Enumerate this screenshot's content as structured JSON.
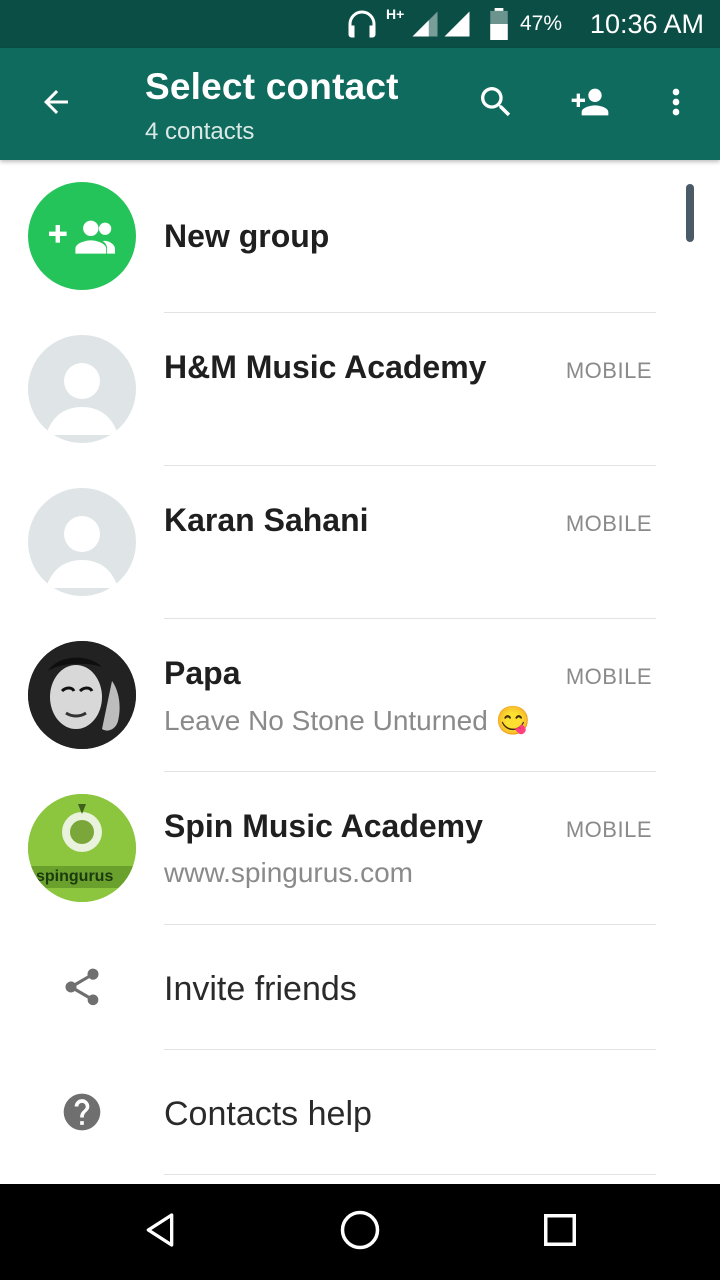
{
  "status_bar": {
    "network_type": "H+",
    "battery_percent": "47%",
    "time": "10:36 AM",
    "icons": [
      "headphones-icon",
      "signal-icon",
      "signal-icon",
      "battery-icon"
    ]
  },
  "app_bar": {
    "title": "Select contact",
    "subtitle": "4 contacts",
    "actions": [
      "back-arrow-icon",
      "search-icon",
      "add-contact-icon",
      "more-vert-icon"
    ]
  },
  "list": {
    "new_group_label": "New group",
    "contacts": [
      {
        "name": "H&M Music Academy",
        "type": "MOBILE",
        "status": "",
        "avatar": "default-avatar"
      },
      {
        "name": "Karan Sahani",
        "type": "MOBILE",
        "status": "",
        "avatar": "default-avatar"
      },
      {
        "name": "Papa",
        "type": "MOBILE",
        "status": "Leave No Stone Unturned",
        "status_emoji": "😋",
        "avatar": "photo-avatar"
      },
      {
        "name": "Spin Music Academy",
        "type": "MOBILE",
        "status": "www.spingurus.com",
        "avatar": "logo-avatar"
      }
    ],
    "invite_label": "Invite friends",
    "help_label": "Contacts help"
  },
  "avatar_logo_text": "spingurus",
  "colors": {
    "status_bar": "#0b4e45",
    "app_bar": "#0f6b5e",
    "accent": "#25c45a",
    "avatar_placeholder": "#dfe5e7"
  }
}
